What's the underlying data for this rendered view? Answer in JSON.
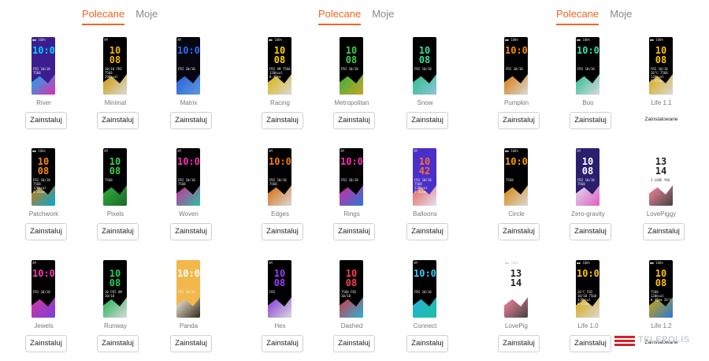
{
  "tabs": {
    "recommended": "Polecane",
    "mine": "Moje"
  },
  "install_label": "Zainstaluj",
  "installed_label": "Zainstalowane",
  "watermark": "TELEPOLIS",
  "accent_color": "#f26522",
  "panels": [
    {
      "faces": [
        {
          "name": "River",
          "status": "●● 100%",
          "time": "10:08",
          "info": "FRI 10/18 7568",
          "colors": [
            "#3a1e8f",
            "#00d0ff",
            "#ff2fb5"
          ]
        },
        {
          "name": "Minimal",
          "status": "AM",
          "time": "10 08",
          "info": "10/18 FRI 7568 298kcal",
          "colors": [
            "#000000",
            "#f5b400",
            "#ffffff"
          ]
        },
        {
          "name": "Matrix",
          "status": "AM",
          "time": "10:08",
          "info": "FRI 10/18",
          "colors": [
            "#05060f",
            "#2b6cff",
            "#6fb4ff"
          ]
        },
        {
          "name": "Patchwork",
          "status": "●● 100%",
          "time": "10 08",
          "info": "FRI 10/18 7568 120kcal 8.45km",
          "colors": [
            "#000000",
            "#ff8a00",
            "#00c8ff"
          ]
        },
        {
          "name": "Pixels",
          "status": "AM",
          "time": "10 08",
          "info": "7568",
          "colors": [
            "#000000",
            "#3bd14a",
            "#1e7a2a"
          ]
        },
        {
          "name": "Woven",
          "status": "AM",
          "time": "10:08",
          "info": "FRI 10/18 7568",
          "colors": [
            "#000000",
            "#ff2fb5",
            "#2fe0c0"
          ]
        },
        {
          "name": "Jewels",
          "status": "AM",
          "time": "10:08",
          "info": "FRI 10/18",
          "colors": [
            "#000000",
            "#ff3dbb",
            "#8a4dff"
          ]
        },
        {
          "name": "Runway",
          "status": "",
          "time": "10 08",
          "info": "10 FRI AM 10/18",
          "colors": [
            "#000000",
            "#1ed15a",
            "#ffffff"
          ]
        },
        {
          "name": "Panda",
          "status": "",
          "time": "10:08",
          "info": "FRI 10/18",
          "colors": [
            "#f2b84b",
            "#ffffff",
            "#111111"
          ]
        }
      ]
    },
    {
      "faces": [
        {
          "name": "Racing",
          "status": "●● 100%",
          "time": "10 08",
          "info": "FRI AM 7568 120kcal 8.45km",
          "colors": [
            "#000000",
            "#ffd400",
            "#ffffff"
          ]
        },
        {
          "name": "Metropolitan",
          "status": "",
          "time": "10 08",
          "info": "FRI 10/18",
          "colors": [
            "#000000",
            "#39d24a",
            "#f0c030"
          ]
        },
        {
          "name": "Snow",
          "status": "",
          "time": "10 08",
          "info": "FRI 10/18",
          "colors": [
            "#000000",
            "#2fe0a0",
            "#a8e8ff"
          ]
        },
        {
          "name": "Edges",
          "status": "AM",
          "time": "10:08",
          "info": "FRI 10/18 7568",
          "colors": [
            "#000000",
            "#ff7a00",
            "#ffffff"
          ]
        },
        {
          "name": "Rings",
          "status": "AM",
          "time": "10:08",
          "info": "FRI 10/18",
          "colors": [
            "#000000",
            "#ff2fb5",
            "#2f8cff"
          ]
        },
        {
          "name": "Balloons",
          "status": "AM",
          "time": "10 42",
          "info": "FRI 10/18 7568 120kcal 8.45km",
          "colors": [
            "#4a2fc8",
            "#ff6a3a",
            "#ffffff"
          ]
        },
        {
          "name": "Hex",
          "status": "AM",
          "time": "10 08",
          "info": "FRI",
          "colors": [
            "#000000",
            "#9a3dff",
            "#ffffff"
          ]
        },
        {
          "name": "Dashed",
          "status": "",
          "time": "10 08",
          "info": "7568 FRI 10/18",
          "colors": [
            "#000000",
            "#ff3d4a",
            "#2fd2ff"
          ]
        },
        {
          "name": "Connect",
          "status": "AM",
          "time": "10:08",
          "info": "FRI 10/18",
          "colors": [
            "#000000",
            "#2fd2ff",
            "#1fe0c0"
          ]
        }
      ]
    },
    {
      "faces": [
        {
          "name": "Pumpkin",
          "status": "●● 100%",
          "time": "10:08",
          "info": "FRI 10/18",
          "colors": [
            "#000000",
            "#ff8a00",
            "#ffffff"
          ]
        },
        {
          "name": "Boo",
          "status": "●● 100%",
          "time": "10:08",
          "info": "FRI 10/18",
          "colors": [
            "#000000",
            "#2fe0b0",
            "#ffffff"
          ]
        },
        {
          "name": "Life 1.1",
          "status": "●● 100%",
          "time": "10 08",
          "info": "FRI 10/18 26°C 7568 120kcal 8.45km",
          "colors": [
            "#000000",
            "#ffc400",
            "#ffffff"
          ]
        },
        {
          "name": "Circle",
          "status": "●● 100%",
          "time": "10:08",
          "info": "7568",
          "colors": [
            "#000000",
            "#ff9a00",
            "#ffffff"
          ]
        },
        {
          "name": "Zero-gravity",
          "status": "AM",
          "time": "10 08",
          "info": "FRI 10/18 7568",
          "colors": [
            "#2a1f6e",
            "#ffffff",
            "#ff6ad5"
          ]
        },
        {
          "name": "LovePiggy",
          "status": "",
          "time": "13 14",
          "info": "I LOVE YOU",
          "colors": [
            "#ffffff",
            "#ff6f8e",
            "#222222"
          ]
        },
        {
          "name": "LovePig",
          "status": "●● 100%",
          "time": "13 14",
          "info": "",
          "colors": [
            "#ffffff",
            "#ff6f8e",
            "#222222"
          ]
        },
        {
          "name": "Life 1.0",
          "status": "●● 100%",
          "time": "10:08",
          "info": "26°C FRI 10/18 7568 120kcal 8.45km",
          "colors": [
            "#000000",
            "#ffc400",
            "#ffffff"
          ]
        },
        {
          "name": "Life 1.2",
          "status": "●● 100%",
          "time": "10 08",
          "info": "7568 120kcal 8.45km 26°C",
          "colors": [
            "#000000",
            "#ffc400",
            "#2f8cff"
          ]
        }
      ]
    }
  ],
  "installed_faces": [
    "Life 1.1",
    "Life 1.2"
  ]
}
